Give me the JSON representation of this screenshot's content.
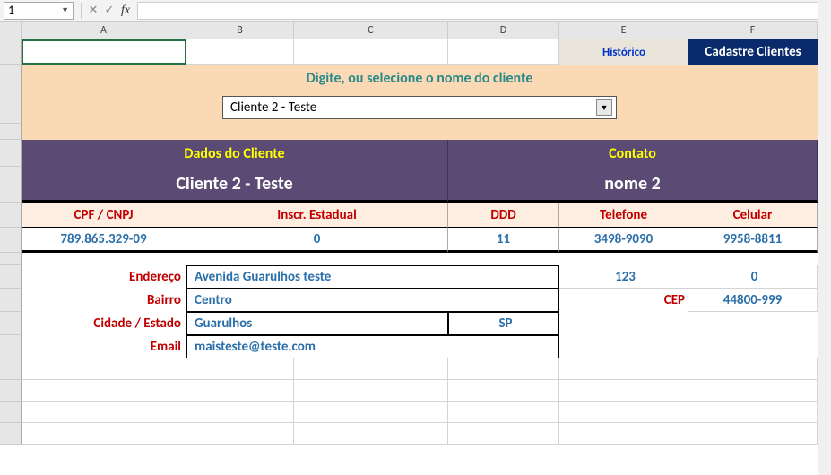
{
  "formula_bar": {
    "name_box": "1"
  },
  "columns": [
    "",
    "A",
    "B",
    "C",
    "D",
    "E",
    "F"
  ],
  "buttons": {
    "historico": "Histórico",
    "cadastre": "Cadastre Clientes"
  },
  "prompt": "Digite, ou selecione o nome do cliente",
  "dropdown_value": "Cliente 2 - Teste",
  "sections": {
    "dados": "Dados  do Cliente",
    "contato": "Contato"
  },
  "client_name": "Cliente 2 - Teste",
  "contact_name": "nome 2",
  "field_headers": {
    "cpf": "CPF / CNPJ",
    "inscr": "Inscr. Estadual",
    "ddd": "DDD",
    "telefone": "Telefone",
    "celular": "Celular"
  },
  "field_values": {
    "cpf": "789.865.329-09",
    "inscr": "0",
    "ddd": "11",
    "telefone": "3498-9090",
    "celular": "9958-8811"
  },
  "addr_labels": {
    "endereco": "Endereço",
    "bairro": "Bairro",
    "cidade": "Cidade / Estado",
    "email": "Email",
    "cep": "CEP"
  },
  "addr_values": {
    "endereco": "Avenida Guarulhos teste",
    "numero": "123",
    "complemento": "0",
    "bairro": "Centro",
    "cep": "44800-999",
    "cidade": "Guarulhos",
    "estado": "SP",
    "email": "maisteste@teste.com"
  }
}
